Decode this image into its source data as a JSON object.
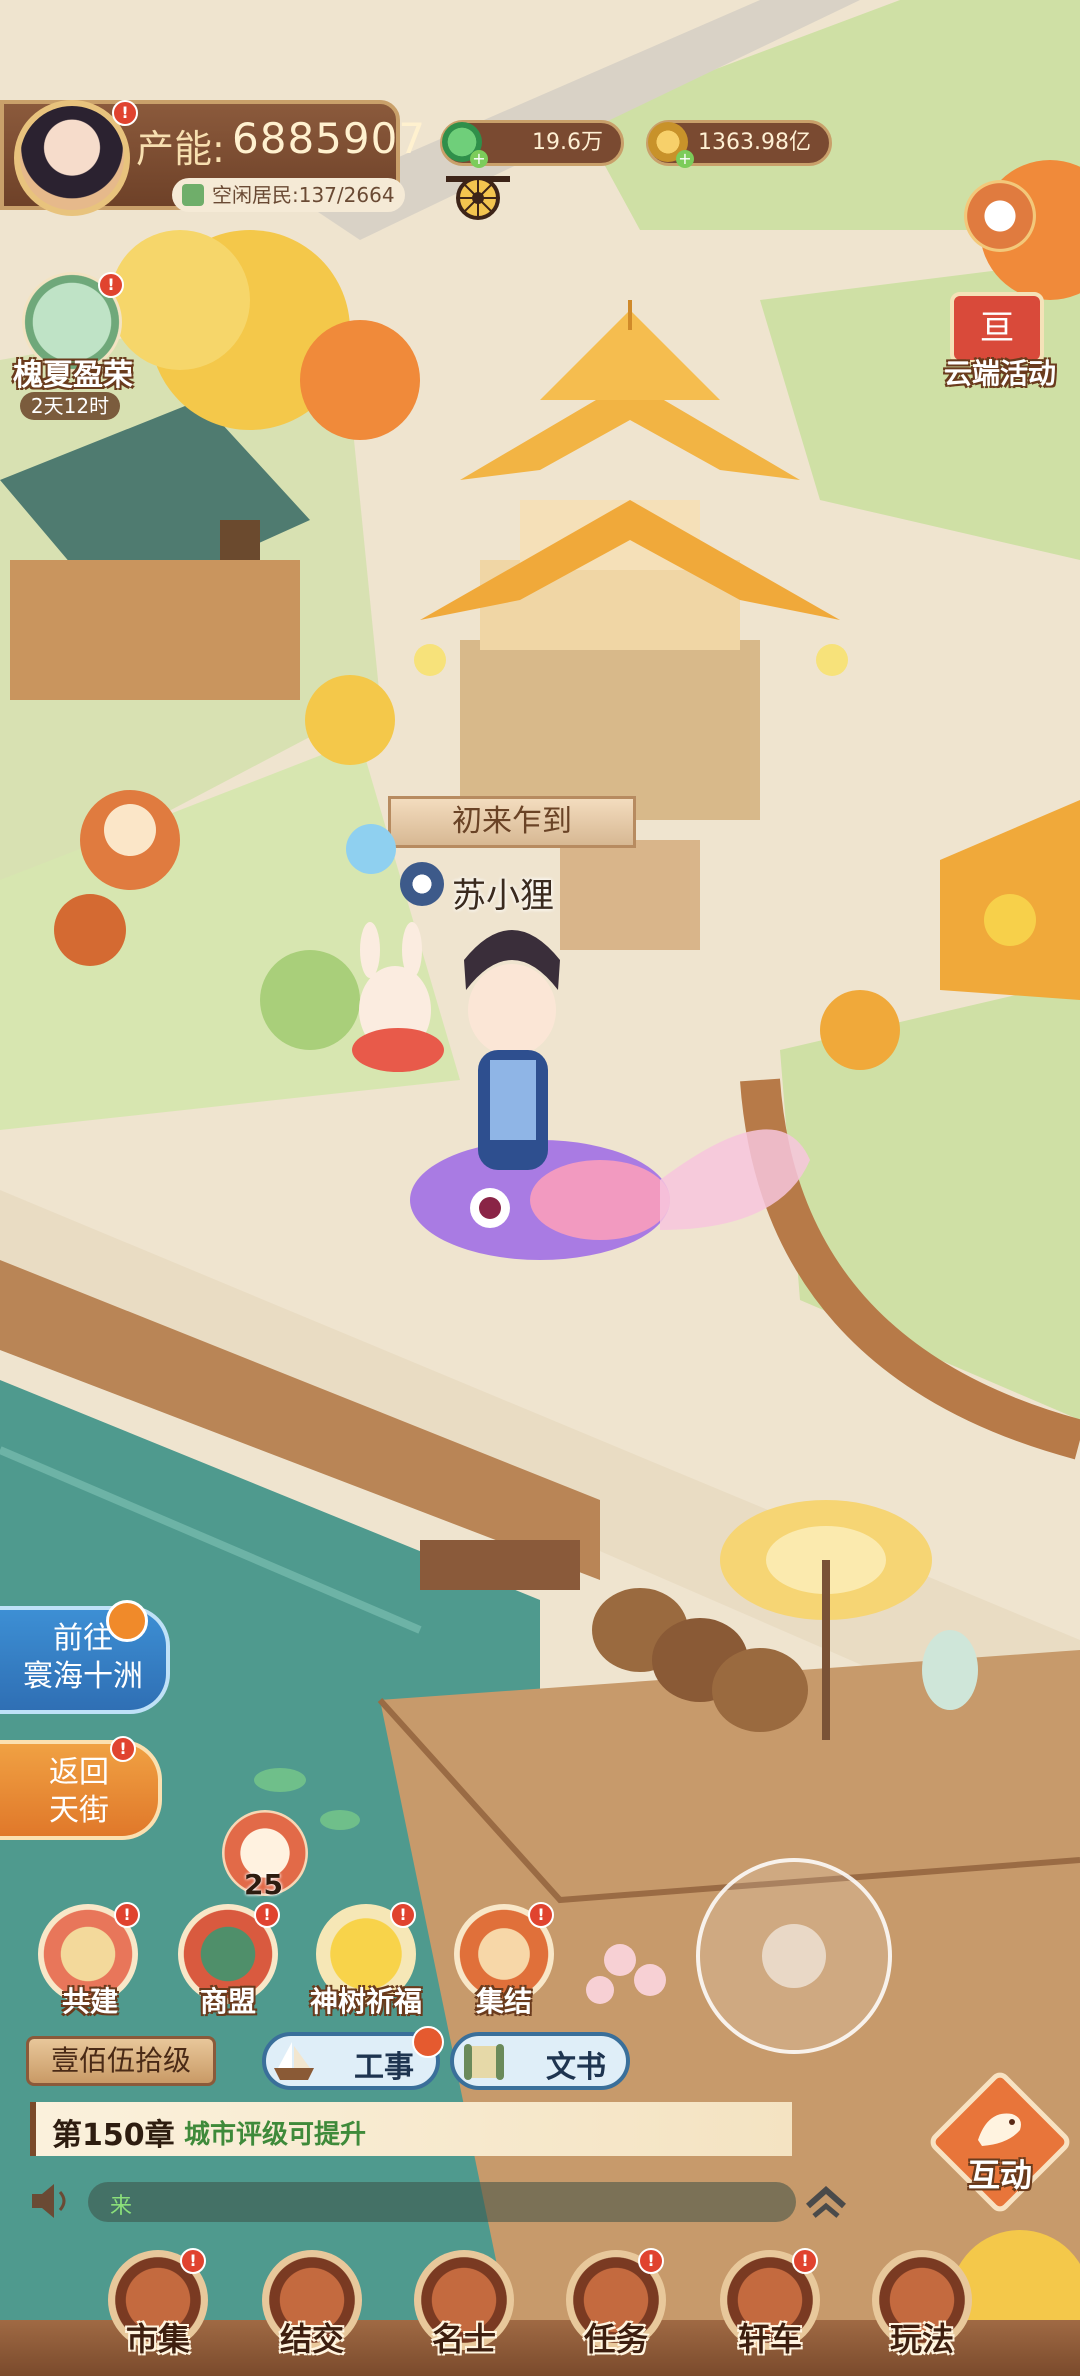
{
  "hud": {
    "power_label": "产能:",
    "power_value": "6885907",
    "idle_residents": "空闲居民:137/2664",
    "jade_amount": "19.6万",
    "coin_amount": "1363.98亿"
  },
  "event": {
    "title": "槐夏盈荣",
    "timer": "2天12时"
  },
  "cloud_activity": "云端活动",
  "npc": {
    "title": "初来乍到",
    "name": "苏小狸"
  },
  "left_buttons": {
    "go_to_line1": "前往",
    "go_to_line2": "寰海十洲",
    "return_line1": "返回",
    "return_line2": "天街"
  },
  "alliance_count": "25",
  "actions": [
    "共建",
    "商盟",
    "神树祈福",
    "集结"
  ],
  "rank_plaque": "壹佰伍拾级",
  "work_button": "工事",
  "docs_button": "文书",
  "chapter": {
    "title": "第150章",
    "hint": "城市评级可提升"
  },
  "chat_placeholder": "来",
  "interact": "互动",
  "bottom_nav": [
    "市集",
    "结交",
    "名士",
    "任务",
    "轩车",
    "玩法"
  ],
  "colors": {
    "hud_brown": "#7a4a31",
    "accent_gold": "#e8c37d",
    "badge_red": "#e0432f",
    "water": "#4f9a8e",
    "blue_button": "#2f7fc4",
    "orange_button": "#e0892f"
  }
}
